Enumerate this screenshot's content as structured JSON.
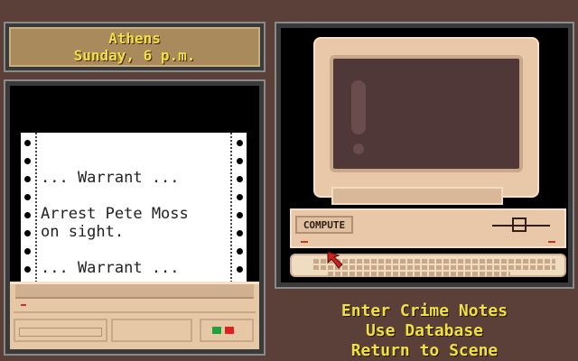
{
  "location": {
    "city": "Athens",
    "time": "Sunday, 6 p.m."
  },
  "printout": {
    "lines": [
      "... Warrant ...",
      "",
      "Arrest Pete Moss",
      "on sight.",
      "",
      "... Warrant ..."
    ]
  },
  "computer": {
    "compute_label": "COMPUTE"
  },
  "menu": {
    "items": [
      "Enter Crime Notes",
      "Use Database",
      "Return to Scene"
    ]
  },
  "colors": {
    "menu_text": "#f0e040",
    "background": "#5a4038",
    "panel_frame": "#8a8a8a",
    "location_bg": "#a88a5c",
    "device_beige": "#e8c8a8"
  }
}
